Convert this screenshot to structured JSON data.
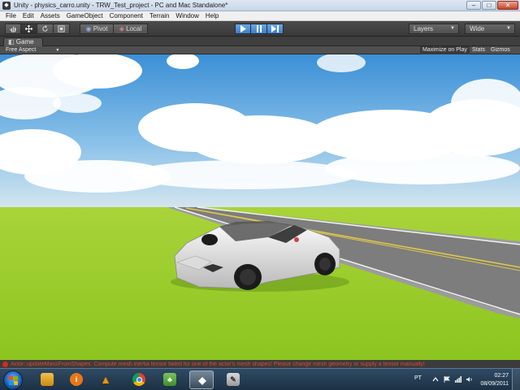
{
  "window": {
    "title": "Unity - physics_carro.unity - TRW_Test_project - PC and Mac Standalone*",
    "app_icon": "unity-icon",
    "minimize": "–",
    "maximize": "□",
    "close": "✕"
  },
  "menu": {
    "items": [
      {
        "label": "File"
      },
      {
        "label": "Edit"
      },
      {
        "label": "Assets"
      },
      {
        "label": "GameObject"
      },
      {
        "label": "Component"
      },
      {
        "label": "Terrain"
      },
      {
        "label": "Window"
      },
      {
        "label": "Help"
      }
    ]
  },
  "toolbar": {
    "transform_tools": [
      "hand-icon",
      "move-icon",
      "rotate-icon",
      "scale-icon"
    ],
    "pivot_label": "Pivot",
    "local_label": "Local",
    "play_controls": [
      "play-icon",
      "pause-icon",
      "step-icon"
    ],
    "layers_label": "Layers",
    "layout_label": "Wide"
  },
  "game_panel": {
    "tab_label": "Game",
    "aspect_label": "Free Aspect",
    "maximize_label": "Maximize on Play",
    "stats_label": "Stats",
    "gizmos_label": "Gizmos"
  },
  "status": {
    "message": "Actor::updateMassFromShapes: Compute mesh inertia tensor failed for one of the actor's mesh shapes! Please change mesh geometry or supply a tensor manually!",
    "error_color": "#d62b1e"
  },
  "taskbar": {
    "apps": [
      {
        "icon": "explorer-icon"
      },
      {
        "icon": "avast-icon"
      },
      {
        "icon": "vlc-icon"
      },
      {
        "icon": "chrome-icon"
      },
      {
        "icon": "game-icon"
      },
      {
        "icon": "unity-icon"
      },
      {
        "icon": "paint-icon"
      }
    ],
    "language": "PT",
    "time": "02:27",
    "date": "08/09/2011"
  }
}
